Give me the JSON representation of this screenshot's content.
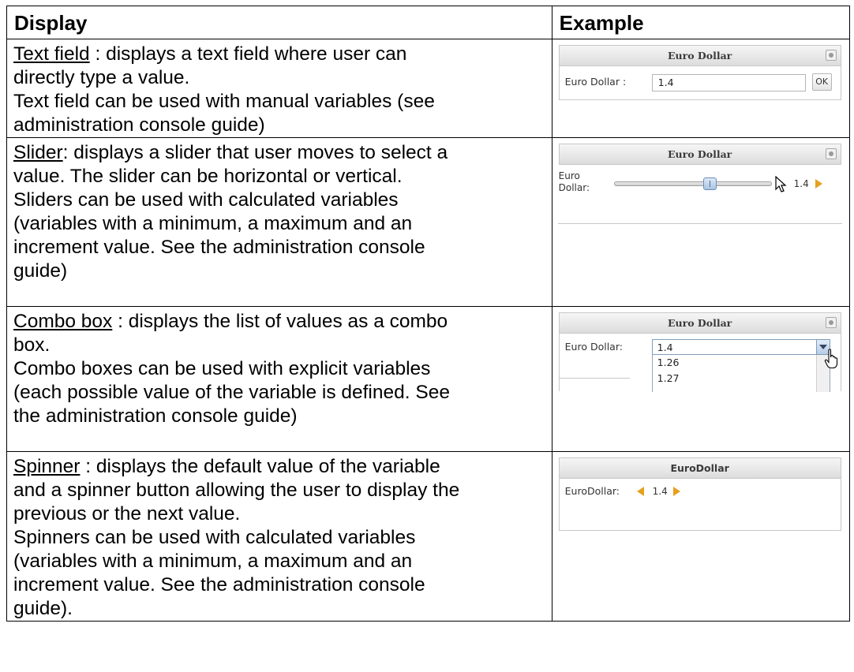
{
  "header": {
    "display": "Display",
    "example": "Example"
  },
  "rows": [
    {
      "name": "Text field",
      "lines": [
        " : displays a text field where user can",
        "directly type a value.",
        "Text field can be used with manual variables (see",
        "administration console guide)"
      ],
      "example": {
        "title": "Euro Dollar",
        "label": "Euro Dollar :",
        "value": "1.4",
        "button": "OK"
      }
    },
    {
      "name": "Slider",
      "lines": [
        ":  displays a slider that user moves to select a",
        "value. The slider can be horizontal or vertical.",
        "Sliders can be used with calculated variables",
        "(variables with a minimum, a maximum and an",
        "increment value. See the administration console",
        "guide)"
      ],
      "example": {
        "title": "Euro Dollar",
        "label_line1": "Euro",
        "label_line2": "Dollar:",
        "value": "1.4",
        "slider_position": 0.62
      }
    },
    {
      "name": "Combo box",
      "lines": [
        " : displays the list of values as a combo",
        "box.",
        "Combo boxes can be used with explicit variables",
        "(each possible value of the variable is defined. See",
        "the administration console guide)"
      ],
      "example": {
        "title": "Euro Dollar",
        "label": "Euro Dollar:",
        "value": "1.4",
        "options": [
          "1.26",
          "1.27"
        ]
      }
    },
    {
      "name": "Spinner",
      "lines": [
        " : displays the default value of the variable",
        "and a spinner button allowing the user to display the",
        "previous or the next value.",
        "Spinners can be used with calculated variables",
        "(variables with a minimum, a maximum and an",
        "increment value. See the administration console",
        "guide)."
      ],
      "example": {
        "title": "EuroDollar",
        "label": "EuroDollar:",
        "value": "1.4"
      }
    }
  ],
  "colors": {
    "spinner_arrows": "#e6a020",
    "panel_border": "#c8c8c8"
  }
}
